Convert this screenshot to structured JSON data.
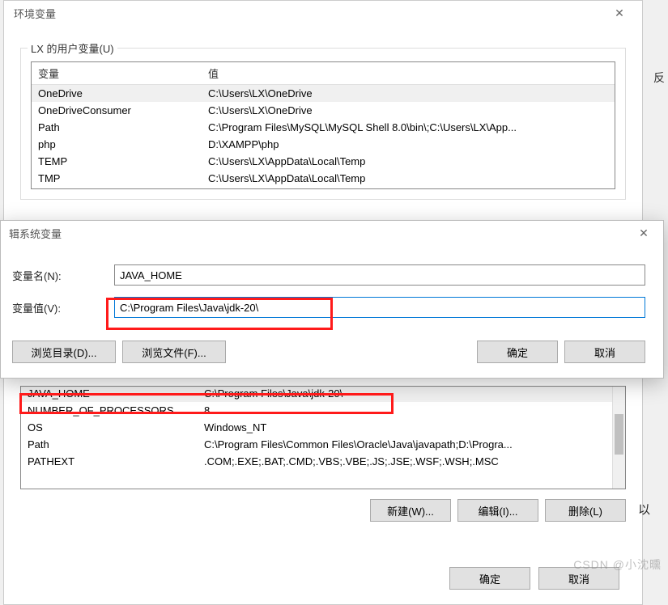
{
  "mainWindow": {
    "title": "环境变量",
    "userGroupLabel": "LX 的用户变量(U)",
    "columns": {
      "var": "变量",
      "val": "值"
    },
    "userVars": [
      {
        "name": "OneDrive",
        "value": "C:\\Users\\LX\\OneDrive"
      },
      {
        "name": "OneDriveConsumer",
        "value": "C:\\Users\\LX\\OneDrive"
      },
      {
        "name": "Path",
        "value": "C:\\Program Files\\MySQL\\MySQL Shell 8.0\\bin\\;C:\\Users\\LX\\App..."
      },
      {
        "name": "php",
        "value": "D:\\XAMPP\\php"
      },
      {
        "name": "TEMP",
        "value": "C:\\Users\\LX\\AppData\\Local\\Temp"
      },
      {
        "name": "TMP",
        "value": "C:\\Users\\LX\\AppData\\Local\\Temp"
      }
    ],
    "sysVars": [
      {
        "name": "JAVA_HOME",
        "value": "C:\\Program Files\\Java\\jdk-20\\"
      },
      {
        "name": "NUMBER_OF_PROCESSORS",
        "value": "8"
      },
      {
        "name": "OS",
        "value": "Windows_NT"
      },
      {
        "name": "Path",
        "value": "C:\\Program Files\\Common Files\\Oracle\\Java\\javapath;D:\\Progra..."
      },
      {
        "name": "PATHEXT",
        "value": ".COM;.EXE;.BAT;.CMD;.VBS;.VBE;.JS;.JSE;.WSF;.WSH;.MSC"
      }
    ],
    "buttons": {
      "new": "新建(W)...",
      "edit": "编辑(I)...",
      "delete": "删除(L)",
      "ok": "确定",
      "cancel": "取消"
    }
  },
  "editDialog": {
    "title": "辑系统变量",
    "nameLabel": "变量名(N):",
    "valueLabel": "变量值(V):",
    "nameValue": "JAVA_HOME",
    "valueValue": "C:\\Program Files\\Java\\jdk-20\\",
    "buttons": {
      "browseDir": "浏览目录(D)...",
      "browseFile": "浏览文件(F)...",
      "ok": "确定",
      "cancel": "取消"
    }
  },
  "sideChar": "反",
  "yiChar": "以",
  "watermark": "CSDN @小沈曛"
}
